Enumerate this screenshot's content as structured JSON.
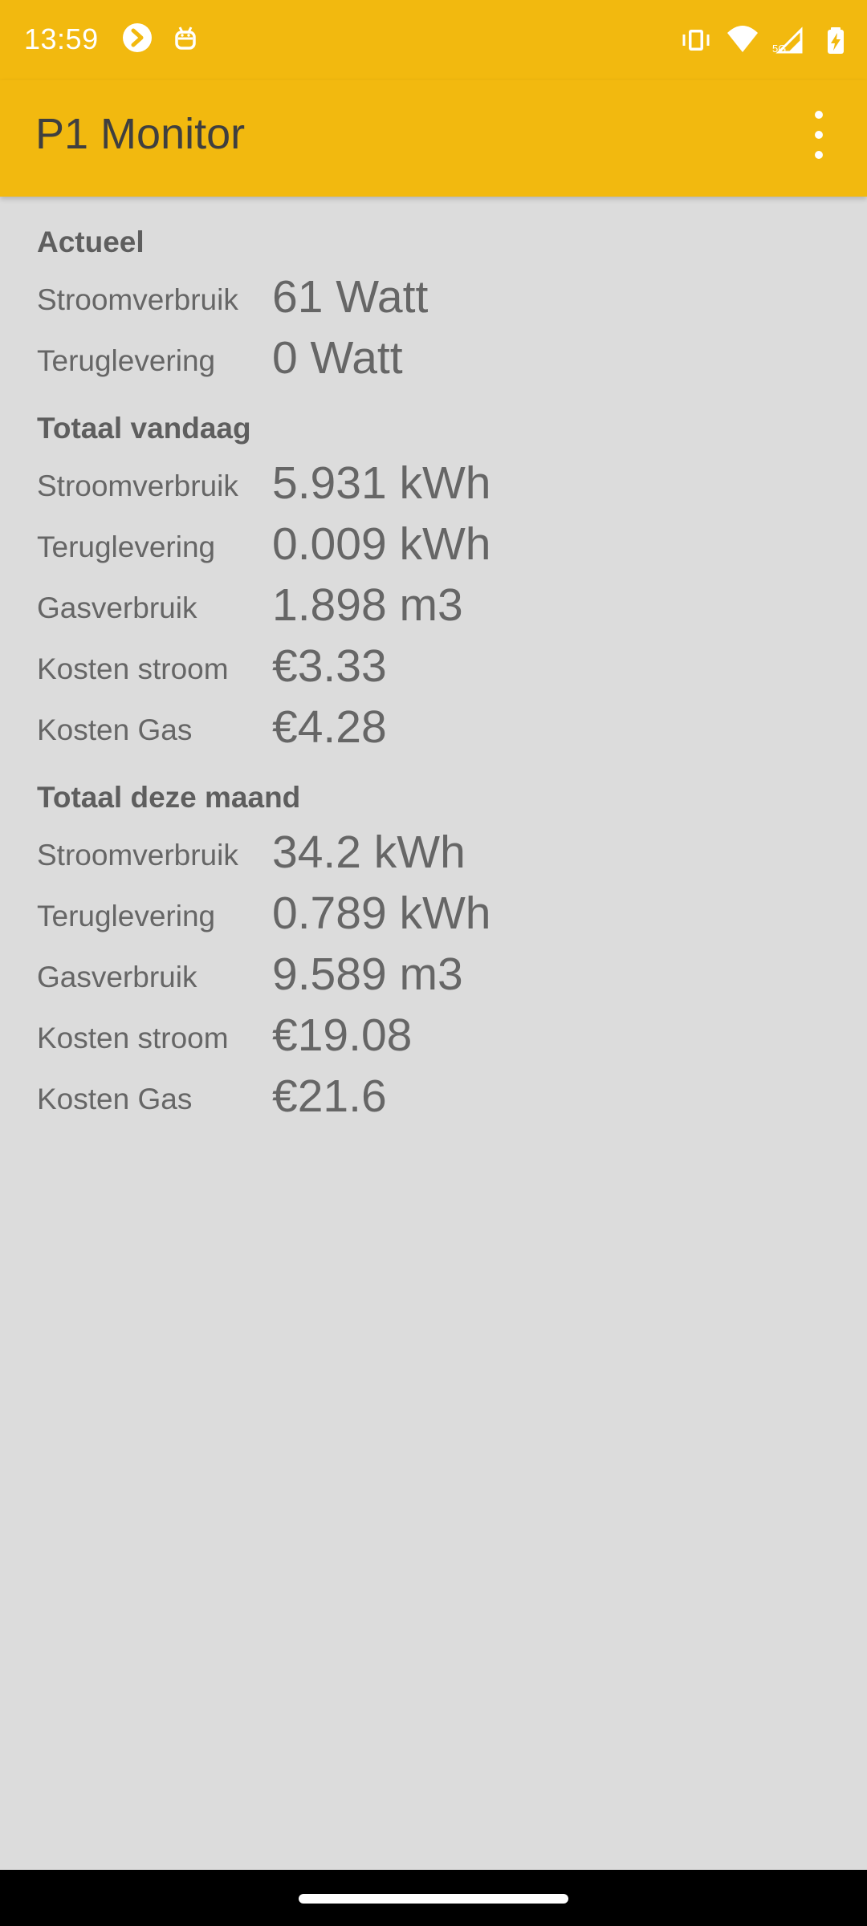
{
  "status_bar": {
    "time": "13:59",
    "left_icons": [
      "sync-badge-icon",
      "android-robot-icon"
    ],
    "right_icons": [
      "vibrate-icon",
      "wifi-icon",
      "cellular-5g-icon",
      "battery-charging-icon"
    ],
    "network_label": "5G"
  },
  "app_bar": {
    "title": "P1 Monitor",
    "menu_icon": "more-vertical-icon",
    "color": "#f2b90f"
  },
  "sections": {
    "actueel": {
      "title": "Actueel",
      "rows": [
        {
          "label": "Stroomverbruik",
          "value": "61 Watt"
        },
        {
          "label": "Teruglevering",
          "value": "0 Watt"
        }
      ]
    },
    "vandaag": {
      "title": "Totaal vandaag",
      "rows": [
        {
          "label": "Stroomverbruik",
          "value": "5.931 kWh"
        },
        {
          "label": "Teruglevering",
          "value": "0.009 kWh"
        },
        {
          "label": "Gasverbruik",
          "value": "1.898 m3"
        },
        {
          "label": "Kosten stroom",
          "value": "€3.33"
        },
        {
          "label": "Kosten Gas",
          "value": "€4.28"
        }
      ]
    },
    "maand": {
      "title": "Totaal deze maand",
      "rows": [
        {
          "label": "Stroomverbruik",
          "value": "34.2 kWh"
        },
        {
          "label": "Teruglevering",
          "value": "0.789 kWh"
        },
        {
          "label": "Gasverbruik",
          "value": "9.589 m3"
        },
        {
          "label": "Kosten stroom",
          "value": "€19.08"
        },
        {
          "label": "Kosten Gas",
          "value": "€21.6"
        }
      ]
    }
  },
  "colors": {
    "background": "#dcdcdc",
    "text": "#666666",
    "navbar": "#000000"
  }
}
